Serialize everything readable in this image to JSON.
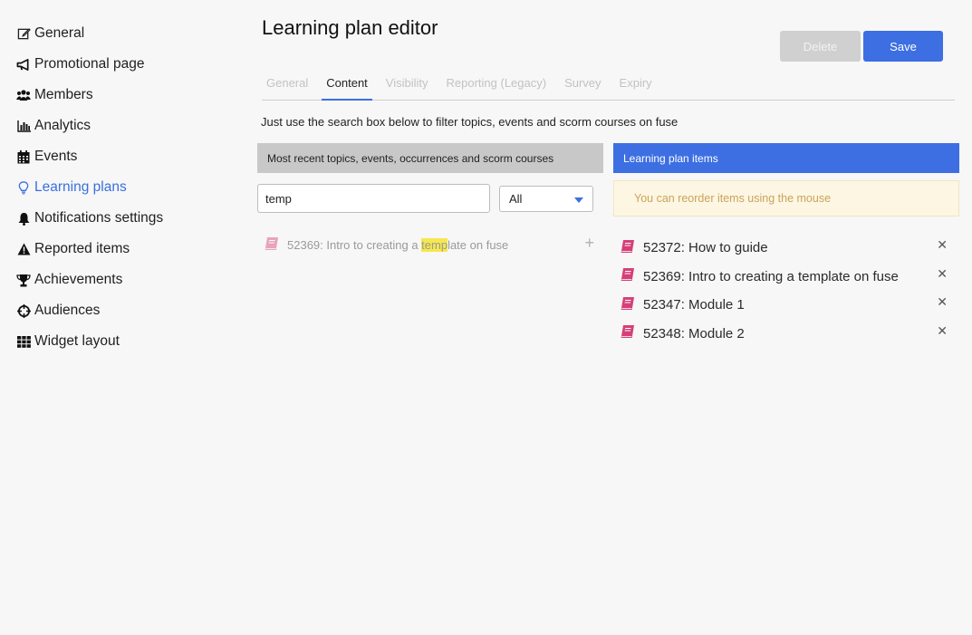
{
  "sidebar": {
    "items": [
      {
        "label": "General",
        "icon": "edit-icon"
      },
      {
        "label": "Promotional page",
        "icon": "megaphone-icon"
      },
      {
        "label": "Members",
        "icon": "users-icon"
      },
      {
        "label": "Analytics",
        "icon": "chart-icon"
      },
      {
        "label": "Events",
        "icon": "calendar-icon"
      },
      {
        "label": "Learning plans",
        "icon": "lightbulb-icon",
        "active": true
      },
      {
        "label": "Notifications settings",
        "icon": "bell-icon"
      },
      {
        "label": "Reported items",
        "icon": "warning-icon"
      },
      {
        "label": "Achievements",
        "icon": "trophy-icon"
      },
      {
        "label": "Audiences",
        "icon": "crosshair-icon"
      },
      {
        "label": "Widget layout",
        "icon": "grid-icon"
      }
    ]
  },
  "header": {
    "title": "Learning plan editor",
    "delete_label": "Delete",
    "save_label": "Save"
  },
  "tabs": [
    {
      "label": "General"
    },
    {
      "label": "Content",
      "active": true
    },
    {
      "label": "Visibility"
    },
    {
      "label": "Reporting (Legacy)"
    },
    {
      "label": "Survey"
    },
    {
      "label": "Expiry"
    }
  ],
  "content": {
    "hint": "Just use the search box below to filter topics, events and scorm courses on fuse",
    "left_panel": {
      "title": "Most recent topics, events, occurrences and scorm courses",
      "search_value": "temp",
      "filter_value": "All",
      "results": [
        {
          "prefix": "52369: Intro to creating a ",
          "highlight": "temp",
          "suffix": "late on fuse",
          "add_symbol": "+"
        }
      ]
    },
    "right_panel": {
      "title": "Learning plan items",
      "notice": "You can reorder items using the mouse",
      "items": [
        {
          "label": "52372: How to guide"
        },
        {
          "label": "52369: Intro to creating a template on fuse"
        },
        {
          "label": "52347: Module 1"
        },
        {
          "label": "52348: Module 2"
        }
      ],
      "remove_symbol": "✕"
    }
  },
  "colors": {
    "accent": "#3d6fe2",
    "book_icon": "#d63f77",
    "highlight": "#f6e84e",
    "notice_text": "#c9a45a"
  }
}
